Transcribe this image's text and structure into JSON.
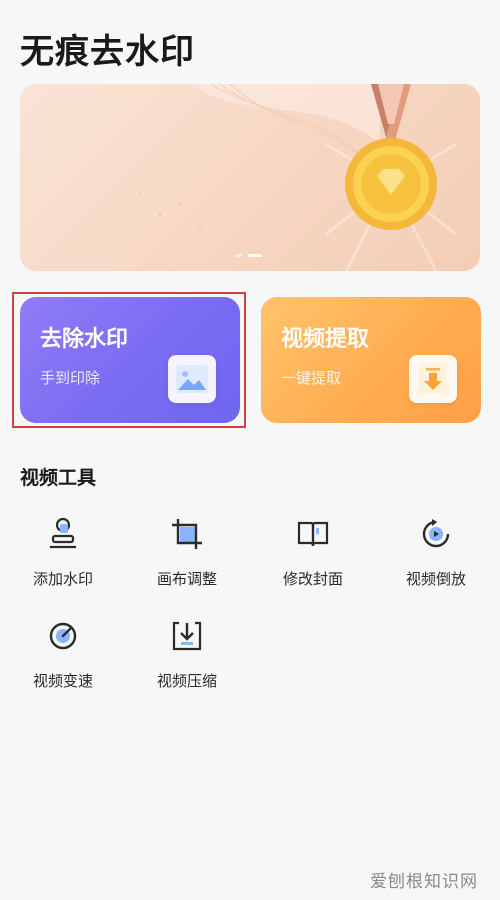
{
  "page": {
    "title": "无痕去水印"
  },
  "banner": {
    "active_slide": 2,
    "slide_count": 2
  },
  "cards": [
    {
      "title": "去除水印",
      "subtitle": "手到印除",
      "color": "#7a6cf3",
      "icon": "image-icon"
    },
    {
      "title": "视频提取",
      "subtitle": "一键提取",
      "color": "#ffae52",
      "icon": "download-icon"
    }
  ],
  "tools_section": {
    "title": "视频工具",
    "items": [
      {
        "label": "添加水印",
        "icon": "stamp-icon"
      },
      {
        "label": "画布调整",
        "icon": "crop-icon"
      },
      {
        "label": "修改封面",
        "icon": "book-icon"
      },
      {
        "label": "视频倒放",
        "icon": "reverse-play-icon"
      },
      {
        "label": "视频变速",
        "icon": "speed-gauge-icon"
      },
      {
        "label": "视频压缩",
        "icon": "compress-icon"
      }
    ]
  },
  "watermark": "爱刨根知识网",
  "colors": {
    "accent_blue": "#4b8df8",
    "icon_dark": "#2b2b2b",
    "highlight": "#c94545"
  }
}
